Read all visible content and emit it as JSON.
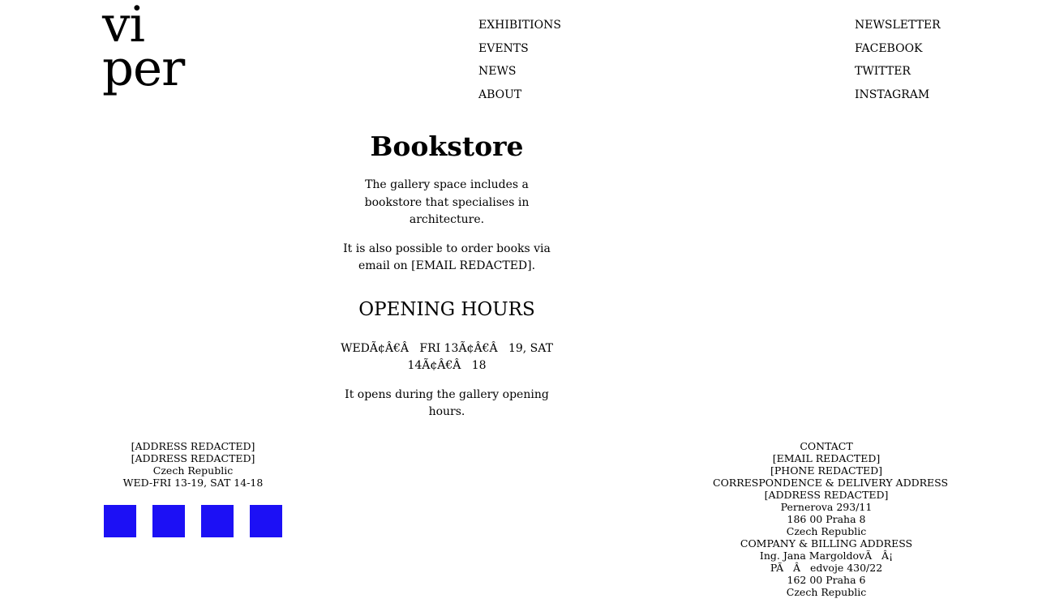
{
  "logo": {
    "line1": "vi",
    "line2": "per"
  },
  "nav_main": [
    "EXHIBITIONS",
    "EVENTS",
    "NEWS",
    "ABOUT"
  ],
  "nav_social": [
    "NEWSLETTER",
    "FACEBOOK",
    "TWITTER",
    "INSTAGRAM"
  ],
  "main": {
    "title": "Bookstore",
    "intro": "The gallery space includes a bookstore that specialises in architecture.",
    "order": "It is also possible to order books via email on [EMAIL REDACTED].",
    "hours_heading": "OPENING HOURS",
    "hours": "WEDÃ¢Â€Â   FRI 13Ã¢Â€Â   19, SAT 14Ã¢Â€Â   18",
    "hours_note": "It opens during the gallery opening hours."
  },
  "footer_left": {
    "lines": [
      "[ADDRESS REDACTED]",
      "[ADDRESS REDACTED]",
      "Czech Republic",
      "WED-FRI 13-19, SAT 14-18"
    ]
  },
  "footer_right": {
    "lines": [
      "CONTACT",
      "[EMAIL REDACTED]",
      "[PHONE REDACTED]",
      "CORRESPONDENCE & DELIVERY ADDRESS",
      "[ADDRESS REDACTED]",
      "Pernerova 293/11",
      "186 00 Praha 8",
      "Czech Republic",
      "COMPANY & BILLING ADDRESS",
      "Ing. Jana MargoldovÃ   Â¡",
      "PÃ   Â   edvoje 430/22",
      "162 00 Praha 6",
      "Czech Republic"
    ]
  },
  "colors": {
    "square": "#1c10f5",
    "text": "#000000",
    "background": "#ffffff"
  }
}
